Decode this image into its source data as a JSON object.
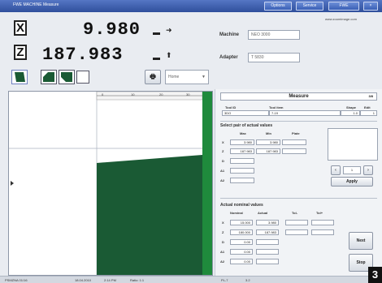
{
  "window": {
    "title": "FWE  MACHINE  Measure",
    "buttons": [
      "Options",
      "Service",
      "FWE"
    ],
    "url": "www.zoomimage.com"
  },
  "readouts": [
    {
      "axis": "X",
      "value": "9.980"
    },
    {
      "axis": "Z",
      "value": "187.983"
    }
  ],
  "machine": {
    "label": "Machine",
    "value": "NEO 3000"
  },
  "adapter": {
    "label": "Adapter",
    "value": "T 5830"
  },
  "toolbar": {
    "dropdown": "Home"
  },
  "view": {
    "ruler_ticks": [
      "0",
      "10",
      "20",
      "30"
    ],
    "profile_color": "#1a5a34",
    "side_bar_color": "#1f8a3c"
  },
  "panel": {
    "title": "Measure",
    "title_meta": "3/8",
    "tool_headers": [
      "Tool ID",
      "Tool item",
      "Shape",
      "Edit"
    ],
    "tool_row": [
      "3DO",
      "7-19",
      "1.0",
      "1"
    ],
    "actual_section": "Select pair of actual values",
    "actual_headers": [
      "Max",
      "Min",
      "Plate"
    ],
    "actual_rows": [
      {
        "label": "X",
        "max": "3.980",
        "min": "3.980"
      },
      {
        "label": "Z",
        "max": "187.983",
        "min": "187.983"
      },
      {
        "label": "D",
        "max": "",
        "min": ""
      },
      {
        "label": "A1",
        "max": "",
        "min": ""
      },
      {
        "label": "A2",
        "max": "",
        "min": ""
      }
    ],
    "spinner_value": "1",
    "apply_label": "Apply",
    "nominal_section": "Actual nominal values",
    "nominal_headers": [
      "Nominal",
      "Actual",
      "Tol-",
      "Tol+"
    ],
    "nominal_rows": [
      {
        "label": "X",
        "nominal": "15.000",
        "actual": "3.980"
      },
      {
        "label": "Z",
        "nominal": "180.000",
        "actual": "187.983"
      },
      {
        "label": "D",
        "nominal": "0.00",
        "actual": ""
      },
      {
        "label": "A1",
        "nominal": "0.00",
        "actual": ""
      },
      {
        "label": "A2",
        "nominal": "0.00",
        "actual": ""
      }
    ],
    "button_next": "Next",
    "button_stop": "Stop"
  },
  "status": [
    "PSMZNA 01/16",
    "18.04.2010",
    "2:14 PM",
    "Ratio: 1:1",
    "PL-7",
    "3.2"
  ],
  "badge": "3"
}
